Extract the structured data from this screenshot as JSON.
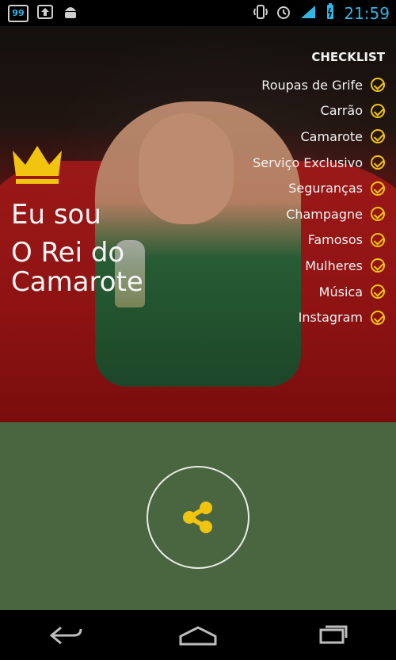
{
  "status_bar": {
    "left_icons": [
      {
        "name": "notification-99-icon",
        "text": "99"
      },
      {
        "name": "upload-icon"
      },
      {
        "name": "android-icon"
      }
    ],
    "right_icons": [
      {
        "name": "vibrate-icon"
      },
      {
        "name": "alarm-icon"
      },
      {
        "name": "signal-icon"
      },
      {
        "name": "battery-icon"
      }
    ],
    "time": "21:59",
    "accent_color": "#33b5e5"
  },
  "hero": {
    "title_line_1": "Eu sou",
    "title_line_2": "O Rei do Camarote",
    "crown_color": "#f1c40f"
  },
  "checklist": {
    "title": "CHECKLIST",
    "items": [
      {
        "label": "Roupas de Grife",
        "checked": true
      },
      {
        "label": "Carrão",
        "checked": true
      },
      {
        "label": "Camarote",
        "checked": true
      },
      {
        "label": "Serviço Exclusivo",
        "checked": true
      },
      {
        "label": "Seguranças",
        "checked": true
      },
      {
        "label": "Champagne",
        "checked": true
      },
      {
        "label": "Famosos",
        "checked": true
      },
      {
        "label": "Mulheres",
        "checked": true
      },
      {
        "label": "Música",
        "checked": true
      },
      {
        "label": "Instagram",
        "checked": true
      }
    ],
    "check_color": "#f1c40f"
  },
  "share": {
    "icon": "share-icon",
    "background_color": "#4a6640",
    "icon_color": "#f1c40f"
  },
  "nav_bar": {
    "buttons": [
      {
        "name": "back-button",
        "icon": "back-icon"
      },
      {
        "name": "home-button",
        "icon": "home-icon"
      },
      {
        "name": "recents-button",
        "icon": "recents-icon"
      }
    ]
  }
}
